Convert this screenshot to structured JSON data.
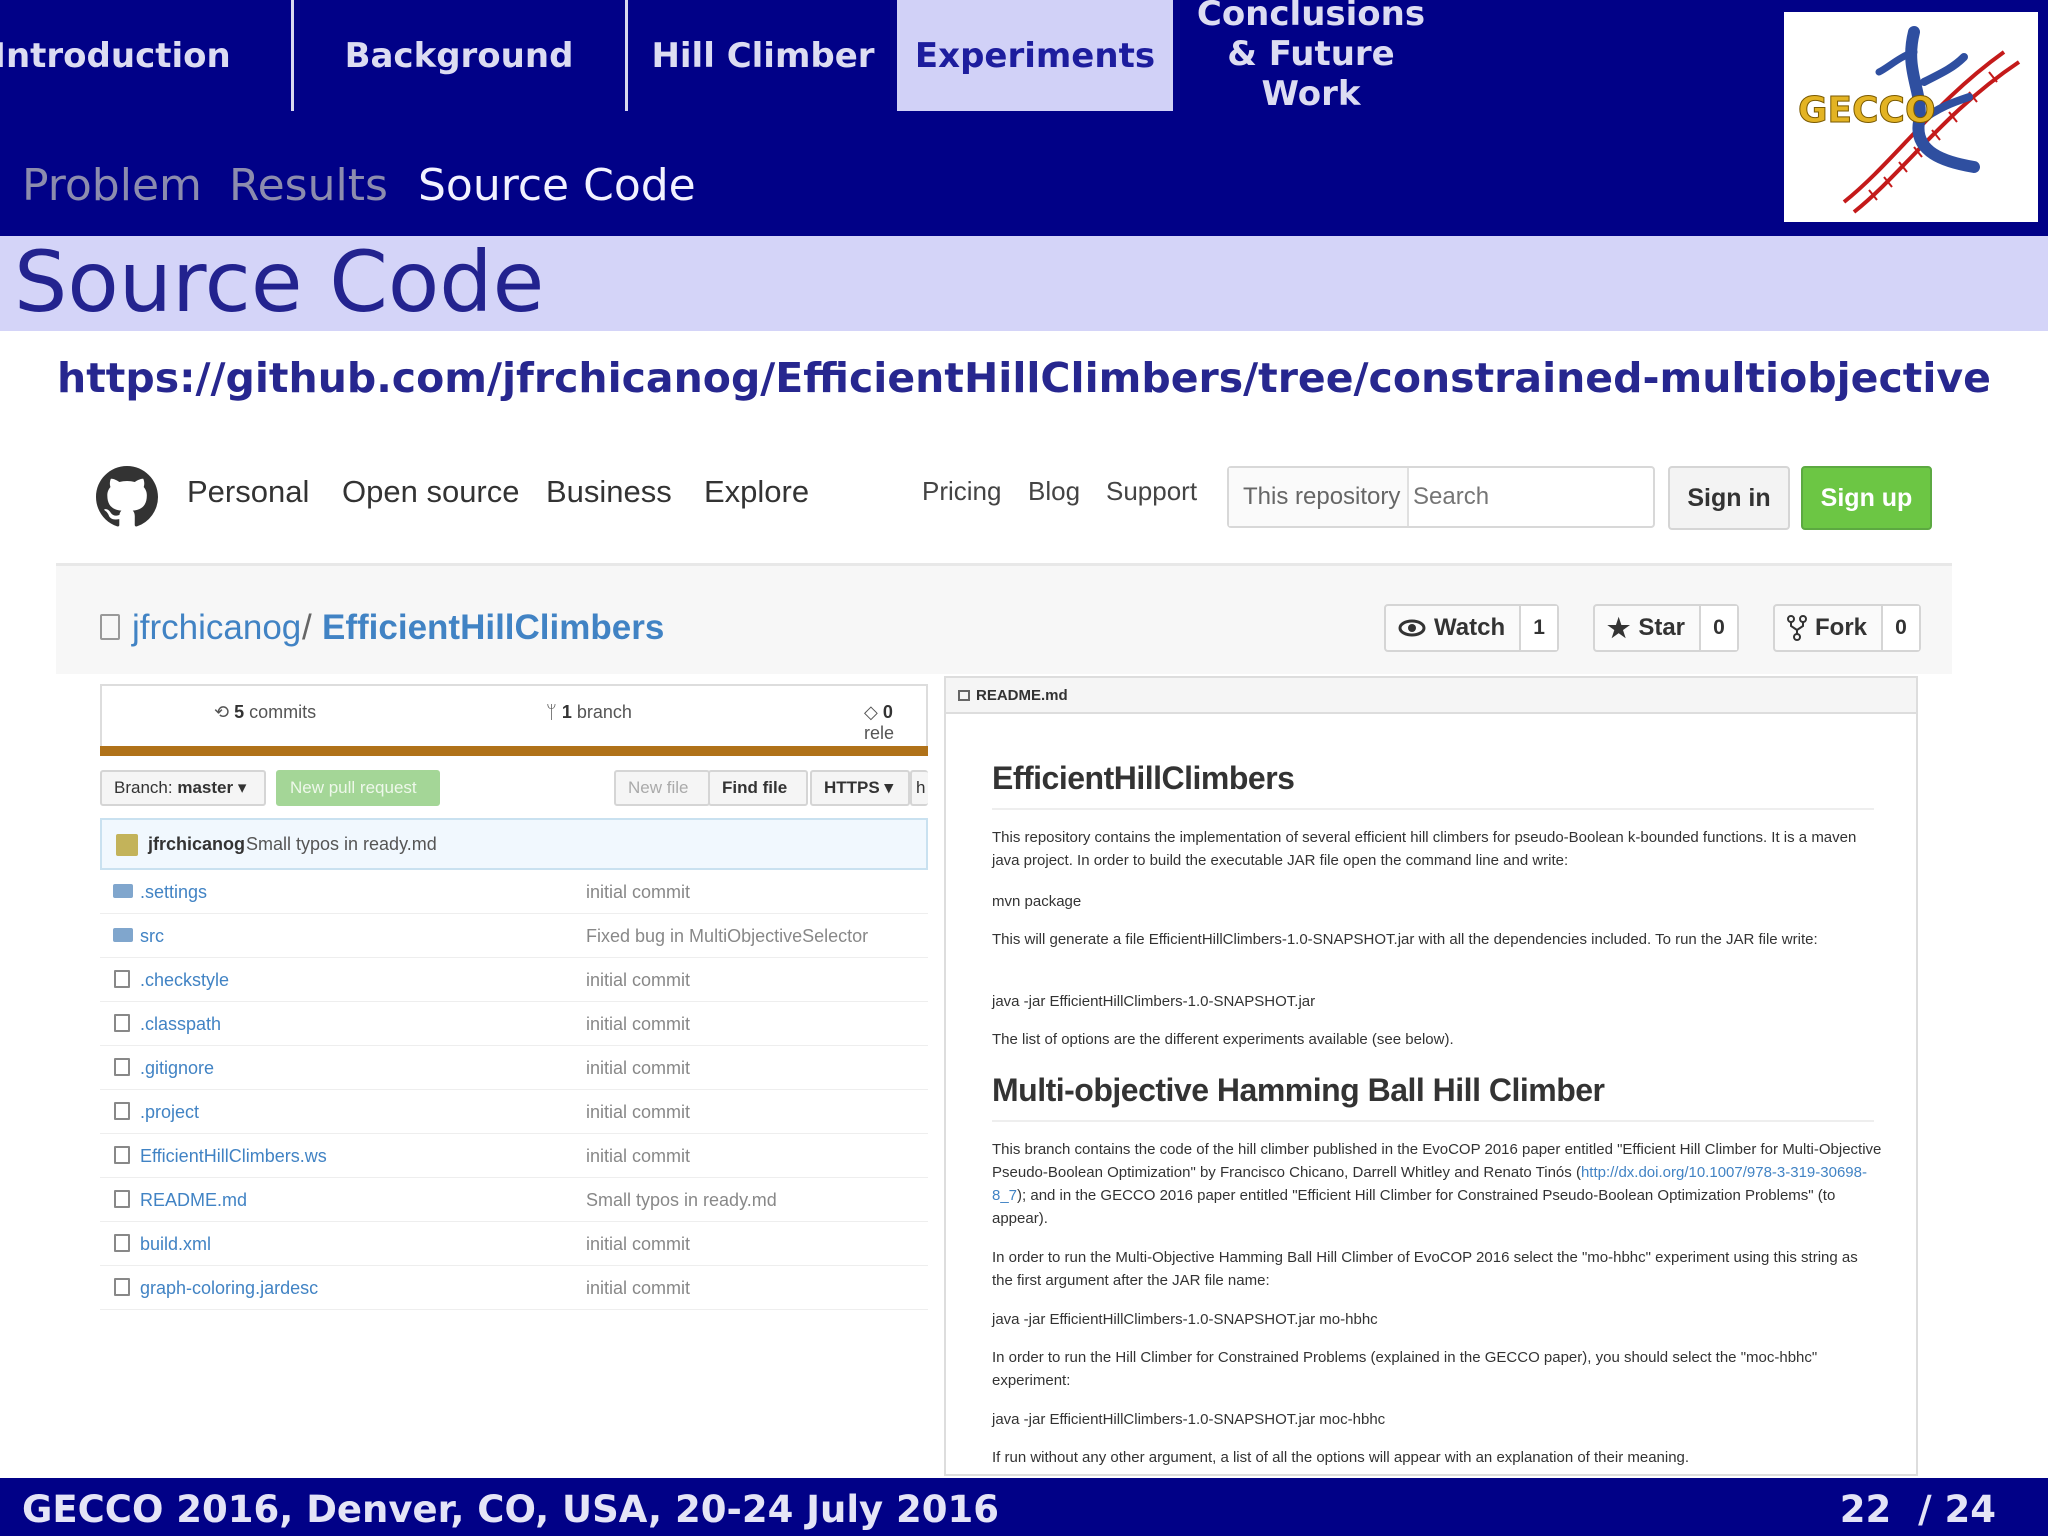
{
  "header": {
    "nav_tabs": [
      {
        "label": "Introduction"
      },
      {
        "label": "Background"
      },
      {
        "label": "Hill Climber"
      },
      {
        "label": "Experiments"
      },
      {
        "label_line1": "Conclusions",
        "label_line2": "& Future Work"
      }
    ],
    "active_tab": "Experiments",
    "subnav": [
      "Problem",
      "Results",
      "Source Code"
    ],
    "active_subnav": "Source Code",
    "logo_text": "GECCO"
  },
  "slide": {
    "title": "Source Code",
    "url": "https://github.com/jfrchicanog/EfficientHillClimbers/tree/constrained-multiobjective"
  },
  "github": {
    "nav": {
      "links": [
        "Personal",
        "Open source",
        "Business",
        "Explore"
      ],
      "secondary": [
        "Pricing",
        "Blog",
        "Support"
      ],
      "search_scope": "This repository",
      "search_placeholder": "Search",
      "sign_in": "Sign in",
      "sign_up": "Sign up"
    },
    "repo": {
      "owner": "jfrchicanog",
      "separator": "/",
      "name": "EfficientHillClimbers",
      "watch_label": "Watch",
      "watch_count": "1",
      "star_label": "Star",
      "star_count": "0",
      "fork_label": "Fork",
      "fork_count": "0"
    },
    "summary": {
      "commits_num": "5",
      "commits_label": "commits",
      "branch_num": "1",
      "branch_label": "branch",
      "releases_num": "0",
      "releases_label": "rele"
    },
    "toolbar": {
      "branch_prefix": "Branch:",
      "branch_name": "master",
      "new_pull_request": "New pull request",
      "new_file": "New file",
      "find_file": "Find file",
      "clone_protocol": "HTTPS",
      "cut_off": "h"
    },
    "latest_commit": {
      "author": "jfrchicanog",
      "message": "Small typos in ready.md"
    },
    "files": [
      {
        "name": ".settings",
        "message": "initial commit",
        "type": "dir"
      },
      {
        "name": "src",
        "message": "Fixed bug in MultiObjectiveSelector",
        "type": "dir"
      },
      {
        "name": ".checkstyle",
        "message": "initial commit",
        "type": "file"
      },
      {
        "name": ".classpath",
        "message": "initial commit",
        "type": "file"
      },
      {
        "name": ".gitignore",
        "message": "initial commit",
        "type": "file"
      },
      {
        "name": ".project",
        "message": "initial commit",
        "type": "file"
      },
      {
        "name": "EfficientHillClimbers.ws",
        "message": "initial commit",
        "type": "file"
      },
      {
        "name": "README.md",
        "message": "Small typos in ready.md",
        "type": "file"
      },
      {
        "name": "build.xml",
        "message": "initial commit",
        "type": "file"
      },
      {
        "name": "graph-coloring.jardesc",
        "message": "initial commit",
        "type": "file"
      }
    ],
    "readme": {
      "filename": "README.md",
      "h1": "EfficientHillClimbers",
      "p1": "This repository contains the implementation of several efficient hill climbers for pseudo-Boolean k-bounded functions. It is a maven java project. In order to build the executable JAR file open the command line and write:",
      "cmd1": "mvn package",
      "p2": "This will generate a file EfficientHillClimbers-1.0-SNAPSHOT.jar with all the dependencies included. To run the JAR file write:",
      "cmd2": "java -jar EfficientHillClimbers-1.0-SNAPSHOT.jar",
      "p3": "The list of options are the different experiments available (see below).",
      "h2": "Multi-objective Hamming Ball Hill Climber",
      "p4a": "This branch contains the code of the hill climber published in the EvoCOP 2016 paper entitled \"Efficient Hill Climber for Multi-Objective Pseudo-Boolean Optimization\" by Francisco Chicano, Darrell Whitley and Renato Tinós (",
      "p4_link": "http://dx.doi.org/10.1007/978-3-319-30698-8_7",
      "p4b": "); and in the GECCO 2016 paper entitled \"Efficient Hill Climber for Constrained Pseudo-Boolean Optimization Problems\" (to appear).",
      "p5": "In order to run the Multi-Objective Hamming Ball Hill Climber of EvoCOP 2016 select the \"mo-hbhc\" experiment using this string as the first argument after the JAR file name:",
      "cmd3": "java -jar EfficientHillClimbers-1.0-SNAPSHOT.jar mo-hbhc",
      "p6": "In order to run the Hill Climber for Constrained Problems (explained in the GECCO paper), you should select the \"moc-hbhc\" experiment:",
      "cmd4": "java -jar EfficientHillClimbers-1.0-SNAPSHOT.jar moc-hbhc",
      "p7": "If run without any other argument, a list of all the options will appear with an explanation of their meaning."
    }
  },
  "footer": {
    "conference": "GECCO 2016, Denver, CO, USA, 20-24 July 2016",
    "page_current": "22",
    "page_total": "/ 24"
  },
  "colors": {
    "header_bg": "#010187",
    "title_bar": "#d4d4f8",
    "active_tab": "#d1d1f7",
    "github_link": "#4183c4",
    "signup_green": "#6cc644",
    "language_bar": "#b07219"
  }
}
